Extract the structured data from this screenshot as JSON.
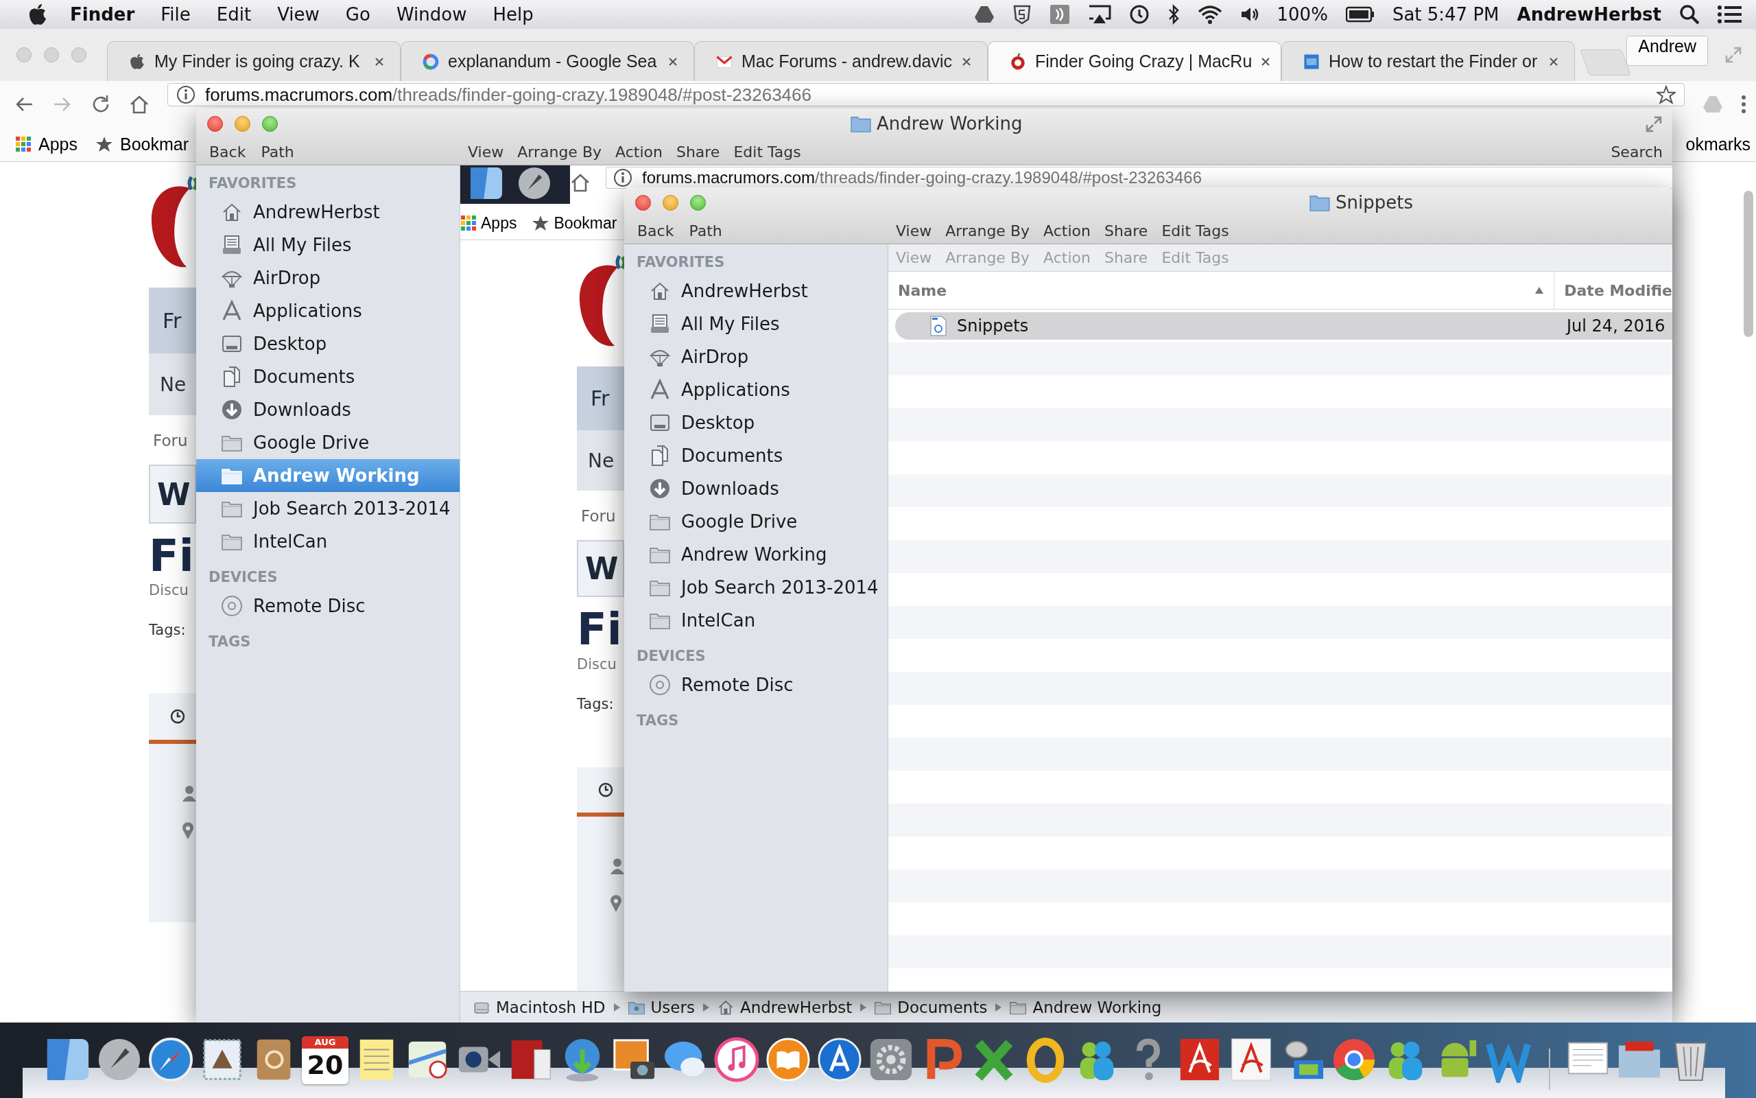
{
  "menu_bar": {
    "app": "Finder",
    "menus": [
      "File",
      "Edit",
      "View",
      "Go",
      "Window",
      "Help"
    ],
    "battery": "100%",
    "clock": "Sat 5:47 PM",
    "user": "AndrewHerbst"
  },
  "browser": {
    "tabs": [
      {
        "title": "My Finder is going crazy. K",
        "kind": "apple",
        "selected": false
      },
      {
        "title": "explanandum - Google Sea",
        "kind": "ring",
        "selected": false
      },
      {
        "title": "Mac Forums - andrew.davic",
        "kind": "envelope",
        "selected": false
      },
      {
        "title": "Finder Going Crazy | MacRu",
        "kind": "red-apple",
        "selected": true
      },
      {
        "title": "How to restart the Finder or",
        "kind": "square",
        "selected": false
      }
    ],
    "profile": "Andrew",
    "address": {
      "host": "forums.macrumors.com",
      "path": "/threads/finder-going-crazy.1989048/#post-23263466"
    },
    "bookmarks": [
      "Apps",
      "Bookmar"
    ],
    "bookmarks_right": "okmarks",
    "page": [
      {
        "kind": "tab",
        "text": "Fr"
      },
      {
        "kind": "subtab",
        "text": "Ne"
      },
      {
        "kind": "crumb",
        "text": "Foru"
      },
      {
        "kind": "button",
        "text": "W"
      },
      {
        "kind": "title",
        "text": "Fi"
      },
      {
        "kind": "meta",
        "text": "Discu"
      },
      {
        "kind": "tags",
        "text": "Tags:"
      }
    ]
  },
  "finder_back": {
    "title": "Andrew Working",
    "toolbar": [
      "Back",
      "Path"
    ],
    "actions": [
      "View",
      "Arrange By",
      "Action",
      "Share",
      "Edit Tags"
    ],
    "search": "Search",
    "sidebar": [
      {
        "heading": "FAVORITES",
        "items": [
          {
            "label": "AndrewHerbst",
            "kind": "home",
            "selected": false
          },
          {
            "label": "All My Files",
            "kind": "files",
            "selected": false
          },
          {
            "label": "AirDrop",
            "kind": "airdrop",
            "selected": false
          },
          {
            "label": "Applications",
            "kind": "apps",
            "selected": false
          },
          {
            "label": "Desktop",
            "kind": "desktop",
            "selected": false
          },
          {
            "label": "Documents",
            "kind": "documents",
            "selected": false
          },
          {
            "label": "Downloads",
            "kind": "downloads",
            "selected": false
          },
          {
            "label": "Google Drive",
            "kind": "folder",
            "selected": false
          },
          {
            "label": "Andrew Working",
            "kind": "folder",
            "selected": true
          },
          {
            "label": "Job Search 2013-2014",
            "kind": "folder",
            "selected": false
          },
          {
            "label": "IntelCan",
            "kind": "folder",
            "selected": false
          }
        ]
      },
      {
        "heading": "DEVICES",
        "items": [
          {
            "label": "Remote Disc",
            "kind": "disc",
            "selected": false
          }
        ]
      },
      {
        "heading": "TAGS"
      }
    ],
    "glitch": {
      "address": {
        "host": "forums.macrumors.com",
        "path": "/threads/finder-going-crazy.1989048/#post-23263466"
      },
      "bookmarks": [
        "Apps",
        "Bookmar"
      ],
      "page": [
        {
          "kind": "tab",
          "text": "Fr"
        },
        {
          "kind": "subtab",
          "text": "Ne"
        },
        {
          "kind": "crumb",
          "text": "Foru"
        },
        {
          "kind": "button",
          "text": "W"
        },
        {
          "kind": "title",
          "text": "Fi"
        },
        {
          "kind": "meta",
          "text": "Discu"
        },
        {
          "kind": "tags",
          "text": "Tags:"
        }
      ]
    },
    "path_bar": [
      {
        "label": "Macintosh HD",
        "kind": "disk"
      },
      {
        "label": "Users",
        "kind": "users"
      },
      {
        "label": "AndrewHerbst",
        "kind": "home"
      },
      {
        "label": "Documents",
        "kind": "folder"
      },
      {
        "label": "Andrew Working",
        "kind": "folder"
      }
    ]
  },
  "finder_front": {
    "title": "Snippets",
    "toolbar": [
      "Back",
      "Path"
    ],
    "actions": [
      "View",
      "Arrange By",
      "Action",
      "Share",
      "Edit Tags"
    ],
    "toolbar_secondary": {
      "disabled": true,
      "items": [
        "View",
        "Arrange By",
        "Action",
        "Share",
        "Edit Tags"
      ]
    },
    "sidebar": [
      {
        "heading": "FAVORITES",
        "items": [
          {
            "label": "AndrewHerbst",
            "kind": "home",
            "selected": false
          },
          {
            "label": "All My Files",
            "kind": "files",
            "selected": false
          },
          {
            "label": "AirDrop",
            "kind": "airdrop",
            "selected": false
          },
          {
            "label": "Applications",
            "kind": "apps",
            "selected": false
          },
          {
            "label": "Desktop",
            "kind": "desktop",
            "selected": false
          },
          {
            "label": "Documents",
            "kind": "documents",
            "selected": false
          },
          {
            "label": "Downloads",
            "kind": "downloads",
            "selected": false
          },
          {
            "label": "Google Drive",
            "kind": "folder",
            "selected": false
          },
          {
            "label": "Andrew Working",
            "kind": "folder",
            "selected": false
          },
          {
            "label": "Job Search 2013-2014",
            "kind": "folder",
            "selected": false
          },
          {
            "label": "IntelCan",
            "kind": "folder",
            "selected": false
          }
        ]
      },
      {
        "heading": "DEVICES",
        "items": [
          {
            "label": "Remote Disc",
            "kind": "disc",
            "selected": false
          }
        ]
      },
      {
        "heading": "TAGS"
      }
    ],
    "columns": [
      {
        "label": "Name",
        "sorted": true
      },
      {
        "label": "Date Modifie",
        "sorted": false
      }
    ],
    "rows": [
      {
        "name": "Snippets",
        "kind": "text-document",
        "date": "Jul 24, 2016",
        "selected": true
      }
    ]
  },
  "dock": {
    "calendar": {
      "month": "AUG",
      "day": "20"
    }
  }
}
